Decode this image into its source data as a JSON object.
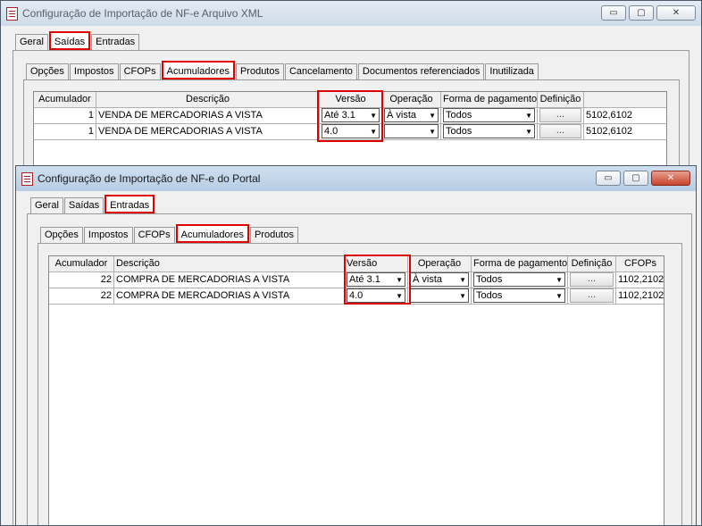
{
  "back_window": {
    "title": "Configuração de Importação de NF-e Arquivo XML",
    "controls": {
      "minimize": "▭",
      "maximize": "▢",
      "close": "✕"
    },
    "tabs": [
      "Geral",
      "Saídas",
      "Entradas"
    ],
    "subtabs": [
      "Opções",
      "Impostos",
      "CFOPs",
      "Acumuladores",
      "Produtos",
      "Cancelamento",
      "Documentos referenciados",
      "Inutilizada"
    ],
    "grid": {
      "columns": [
        "Acumulador",
        "Descrição",
        "Versão",
        "Operação",
        "Forma de pagamento",
        "Definição"
      ],
      "rows": [
        {
          "acumulador": "1",
          "descricao": "VENDA DE MERCADORIAS A VISTA",
          "versao": "Até 3.1",
          "operacao": "À vista",
          "forma": "Todos",
          "definicao": "...",
          "cfops": "5102,6102"
        },
        {
          "acumulador": "1",
          "descricao": "VENDA DE MERCADORIAS A VISTA",
          "versao": "4.0",
          "operacao": "",
          "forma": "Todos",
          "definicao": "...",
          "cfops": "5102,6102"
        }
      ]
    }
  },
  "front_window": {
    "title": "Configuração de Importação de NF-e do Portal",
    "controls": {
      "minimize": "▭",
      "maximize": "▢",
      "close": "✕"
    },
    "tabs": [
      "Geral",
      "Saídas",
      "Entradas"
    ],
    "subtabs": [
      "Opções",
      "Impostos",
      "CFOPs",
      "Acumuladores",
      "Produtos"
    ],
    "grid": {
      "columns": [
        "Acumulador",
        "Descrição",
        "Versão",
        "Operação",
        "Forma de pagamento",
        "Definição",
        "CFOPs"
      ],
      "rows": [
        {
          "acumulador": "22",
          "descricao": "COMPRA DE MERCADORIAS A VISTA",
          "versao": "Até 3.1",
          "operacao": "À vista",
          "forma": "Todos",
          "definicao": "...",
          "cfops": "1102,2102"
        },
        {
          "acumulador": "22",
          "descricao": "COMPRA DE MERCADORIAS A VISTA",
          "versao": "4.0",
          "operacao": "",
          "forma": "Todos",
          "definicao": "...",
          "cfops": "1102,2102"
        }
      ]
    }
  },
  "colors": {
    "highlight": "#e00000",
    "window_border": "#4a5a6a",
    "close_button": "#c7432d"
  },
  "icons": {
    "combo_arrow": "chevron-down-icon",
    "app": "document-icon"
  }
}
